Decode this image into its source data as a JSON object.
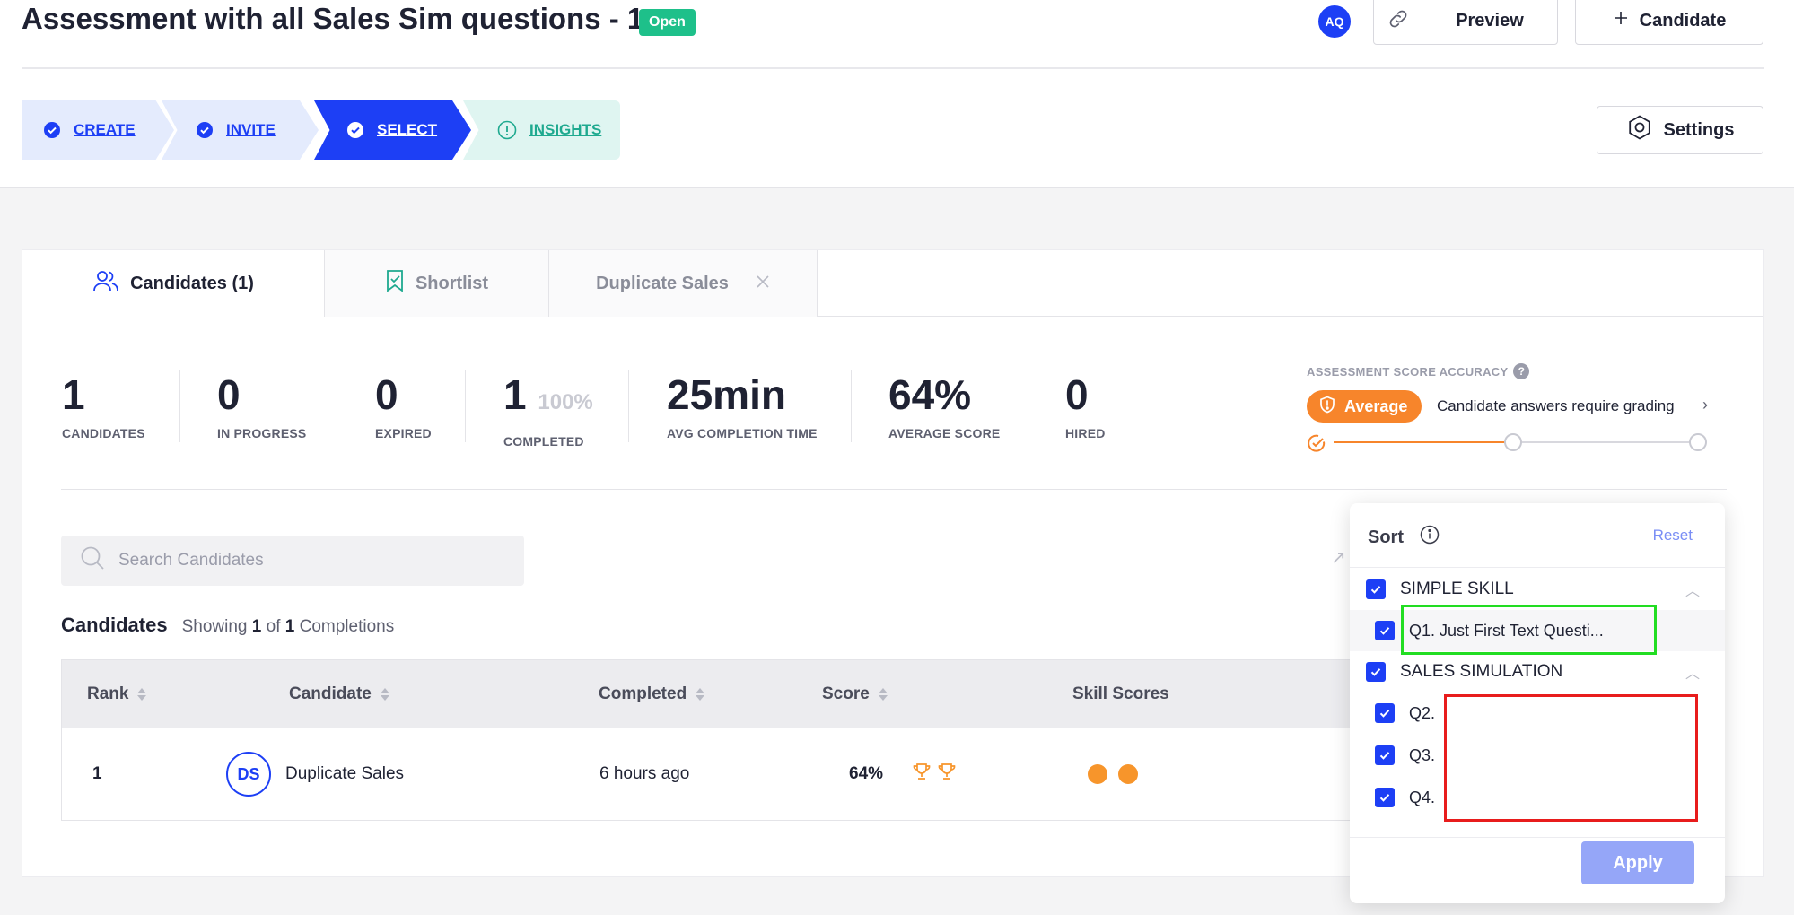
{
  "header": {
    "title": "Assessment with all Sales Sim questions - 1",
    "status": "Open",
    "user_initials": "AQ",
    "preview_label": "Preview",
    "candidate_label": "Candidate",
    "settings_label": "Settings"
  },
  "steps": [
    {
      "label": "CREATE",
      "state": "done"
    },
    {
      "label": "INVITE",
      "state": "done"
    },
    {
      "label": "SELECT",
      "state": "active"
    },
    {
      "label": "INSIGHTS",
      "state": "info"
    }
  ],
  "tabs": [
    {
      "label": "Candidates (1)"
    },
    {
      "label": "Shortlist"
    },
    {
      "label": "Duplicate Sales"
    }
  ],
  "stats": [
    {
      "value": "1",
      "label": "CANDIDATES"
    },
    {
      "value": "0",
      "label": "IN PROGRESS"
    },
    {
      "value": "0",
      "label": "EXPIRED"
    },
    {
      "value": "1",
      "extra": "100%",
      "label": "COMPLETED"
    },
    {
      "value": "25min",
      "label": "AVG COMPLETION TIME"
    },
    {
      "value": "64%",
      "label": "AVERAGE SCORE"
    },
    {
      "value": "0",
      "label": "HIRED"
    }
  ],
  "accuracy": {
    "title": "ASSESSMENT SCORE ACCURACY",
    "help": "?",
    "level": "Average",
    "note": "Candidate answers require grading",
    "step": 1,
    "steps_total": 3
  },
  "search": {
    "placeholder": "Search Candidates"
  },
  "list": {
    "title": "Candidates",
    "showing_prefix": "Showing",
    "shown": "1",
    "of": "of",
    "total": "1",
    "suffix": "Completions"
  },
  "table": {
    "columns": [
      "Rank",
      "Candidate",
      "Completed",
      "Score",
      "Skill Scores"
    ],
    "rows": [
      {
        "rank": "1",
        "initials": "DS",
        "name": "Duplicate Sales",
        "completed": "6 hours ago",
        "score": "64%",
        "trophies": 2,
        "skill_dots": 2
      }
    ]
  },
  "sort_panel": {
    "title": "Sort",
    "reset": "Reset",
    "groups": [
      {
        "label": "SIMPLE SKILL",
        "checked": true,
        "items": [
          {
            "label": "Q1. Just First Text Questi...",
            "checked": true
          }
        ]
      },
      {
        "label": "SALES SIMULATION",
        "checked": true,
        "items": [
          {
            "label": "Q2.",
            "checked": true
          },
          {
            "label": "Q3.",
            "checked": true
          },
          {
            "label": "Q4.",
            "checked": true
          }
        ]
      }
    ],
    "apply": "Apply"
  },
  "colors": {
    "brand": "#1d3ff5",
    "open_badge": "#1ec08a",
    "accuracy": "#f7852b",
    "highlight_green": "#22dd22",
    "highlight_red": "#e81c1c"
  }
}
